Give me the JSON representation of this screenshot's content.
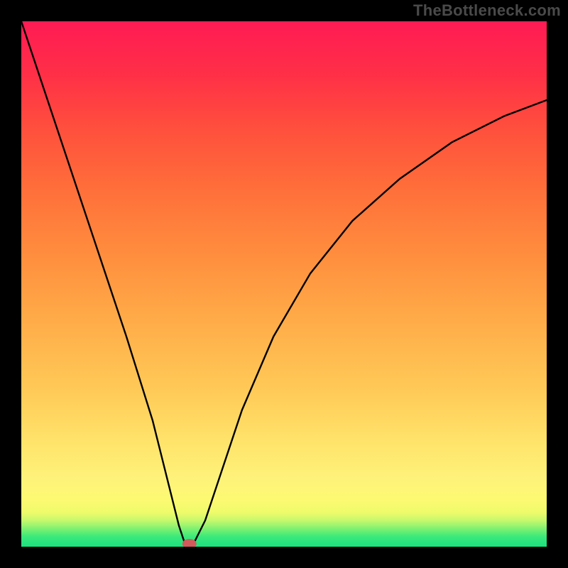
{
  "watermark": "TheBottleneck.com",
  "chart_data": {
    "type": "line",
    "title": "",
    "xlabel": "",
    "ylabel": "",
    "xlim": [
      0,
      100
    ],
    "ylim": [
      0,
      100
    ],
    "grid": false,
    "series": [
      {
        "name": "bottleneck-curve",
        "x": [
          0,
          5,
          10,
          15,
          20,
          25,
          28,
          30,
          31,
          32,
          33,
          35,
          38,
          42,
          48,
          55,
          63,
          72,
          82,
          92,
          100
        ],
        "y": [
          100,
          85,
          70,
          55,
          40,
          24,
          12,
          4,
          1,
          0,
          1,
          5,
          14,
          26,
          40,
          52,
          62,
          70,
          77,
          82,
          85
        ]
      }
    ],
    "background_bands": [
      {
        "y0": 0,
        "y1": 2,
        "color": "#19e37e"
      },
      {
        "y0": 2,
        "y1": 3,
        "color": "#3de97a"
      },
      {
        "y0": 3,
        "y1": 4,
        "color": "#6bef74"
      },
      {
        "y0": 4,
        "y1": 5,
        "color": "#9af470"
      },
      {
        "y0": 5,
        "y1": 6,
        "color": "#c6f86c"
      },
      {
        "y0": 6,
        "y1": 8,
        "color": "#eefb6a"
      },
      {
        "y0": 8,
        "y1": 11,
        "color": "#fdfa72"
      },
      {
        "y0": 11,
        "y1": 16,
        "color": "#fef27a"
      },
      {
        "y0": 16,
        "y1": 100,
        "gradient": true
      }
    ],
    "marker": {
      "x": 32,
      "y": 0,
      "color": "#d35a5a"
    }
  }
}
